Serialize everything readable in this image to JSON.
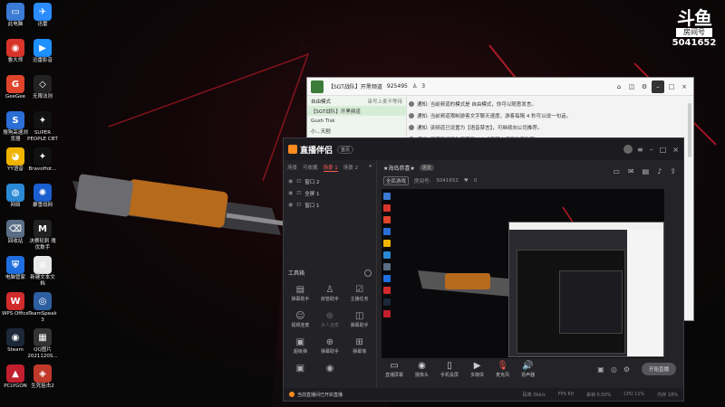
{
  "desktop": {
    "icons": [
      {
        "label": "此电脑",
        "color": "#3a7bd5",
        "glyph": "▭"
      },
      {
        "label": "迅雷",
        "color": "#2a8cff",
        "glyph": "✈"
      },
      {
        "label": "鲁大师",
        "color": "#d9342b",
        "glyph": "◉"
      },
      {
        "label": "迅雷影音",
        "color": "#1e90ff",
        "glyph": "▶"
      },
      {
        "label": "GeeGee",
        "color": "#e0452c",
        "glyph": "G"
      },
      {
        "label": "无限法则",
        "color": "#222",
        "glyph": "◇"
      },
      {
        "label": "搜狗高速浏\n览器",
        "color": "#2b6fd6",
        "glyph": "S"
      },
      {
        "label": "SUPER\nPEOPLE CBT",
        "color": "#111",
        "glyph": "✦"
      },
      {
        "label": "YY语音",
        "color": "#f0b400",
        "glyph": "◕"
      },
      {
        "label": "BravoHot...",
        "color": "#111",
        "glyph": "✦"
      },
      {
        "label": "网络",
        "color": "#2b8ad6",
        "glyph": "◍"
      },
      {
        "label": "暴雪战网",
        "color": "#1a5fd0",
        "glyph": "✺"
      },
      {
        "label": "回收站",
        "color": "#5a6f86",
        "glyph": "⌫"
      },
      {
        "label": "决赛轮刺 瑰\n优数手",
        "color": "#222",
        "glyph": "M"
      },
      {
        "label": "电脑管家",
        "color": "#1f6fe0",
        "glyph": "⛨"
      },
      {
        "label": "新建文本文\n档",
        "color": "#e8e8e8",
        "glyph": "≡"
      },
      {
        "label": "WPS Office",
        "color": "#d12b2b",
        "glyph": "W"
      },
      {
        "label": "TeamSpeak\n3",
        "color": "#2d5fa0",
        "glyph": "◎"
      },
      {
        "label": "Steam",
        "color": "#1b2838",
        "glyph": "◉"
      },
      {
        "label": "QQ图片\n2021120S...",
        "color": "#333",
        "glyph": "▦"
      },
      {
        "label": "PCLYGON",
        "color": "#c21f2e",
        "glyph": "▲"
      },
      {
        "label": "生死狙击2",
        "color": "#c0392b",
        "glyph": "◈"
      }
    ]
  },
  "watermark": {
    "logo": "斗鱼",
    "sub": "房间号",
    "room_number": "5041652"
  },
  "yy_window": {
    "title": "【SGT战队】开黑频道",
    "channel_id": "925495",
    "count": "3",
    "left_list": [
      {
        "text": "自由模式",
        "extra": "串号上麦不等待"
      },
      {
        "text": "【SGT战队】开黑频道",
        "extra": "",
        "highlight": true
      },
      {
        "text": "Gush Tisk",
        "extra": ""
      },
      {
        "text": "小...天剧",
        "extra": ""
      }
    ],
    "messages": [
      "通知: 当前频道的模式是 自由模式，你可以随意发言。",
      "通知: 当前频道限制游客文字聊天速度，游客每隔 4 秒可以说一句话。",
      "通知: 该频道已设置为【语音禁言】，可继续向公司推荐。",
      "通知: 频道已设置为管理员以上成员禁止接受游客私聊。"
    ]
  },
  "app": {
    "logo_text": "直播伴侣",
    "logo_badge": "首页",
    "scene_tabs": [
      "场景",
      "可收藏",
      "场景 1",
      "场景 2"
    ],
    "active_scene_tab": 2,
    "sources": [
      "窗口 2",
      "全屏 1",
      "窗口 1"
    ],
    "tools_title": "工具箱",
    "tools": [
      {
        "label": "弹幕助手",
        "icon": "▤",
        "dim": false
      },
      {
        "label": "房管助手",
        "icon": "♙",
        "dim": false
      },
      {
        "label": "主播任务",
        "icon": "☑",
        "dim": false
      },
      {
        "label": "视频连麦",
        "icon": "☺",
        "dim": false
      },
      {
        "label": "多人连麦",
        "icon": "⊕",
        "dim": true
      },
      {
        "label": "弹幕助手",
        "icon": "◫",
        "dim": false
      },
      {
        "label": "超级弹",
        "icon": "▣",
        "dim": false
      },
      {
        "label": "弹幕助手",
        "icon": "⊕",
        "dim": false
      },
      {
        "label": "弹幕墙",
        "icon": "⊞",
        "dim": false
      },
      {
        "label": "",
        "icon": "▣",
        "dim": false
      },
      {
        "label": "",
        "icon": "◉",
        "dim": false
      }
    ],
    "room_title": "★海岛恭喜★",
    "room_badge": "更改",
    "room_category": "全民游戏",
    "room_number_label": "房间号:",
    "room_number": "5041652",
    "likes": "0",
    "bottom_items": [
      {
        "label": "直播屏幕",
        "icon": "▭"
      },
      {
        "label": "摄像头",
        "icon": "◉"
      },
      {
        "label": "手机投屏",
        "icon": "▯"
      },
      {
        "label": "多媒体",
        "icon": "▶"
      },
      {
        "label": "麦克风",
        "icon": "🎙"
      },
      {
        "label": "扬声器",
        "icon": "🔊"
      }
    ],
    "go_live_label": "开始直播",
    "status_note": "当前直播间已开启直播",
    "status_items": [
      "码率 0kb/s",
      "FPS 60",
      "丢帧 0.00%",
      "CPU 11%",
      "内存 18%"
    ]
  }
}
